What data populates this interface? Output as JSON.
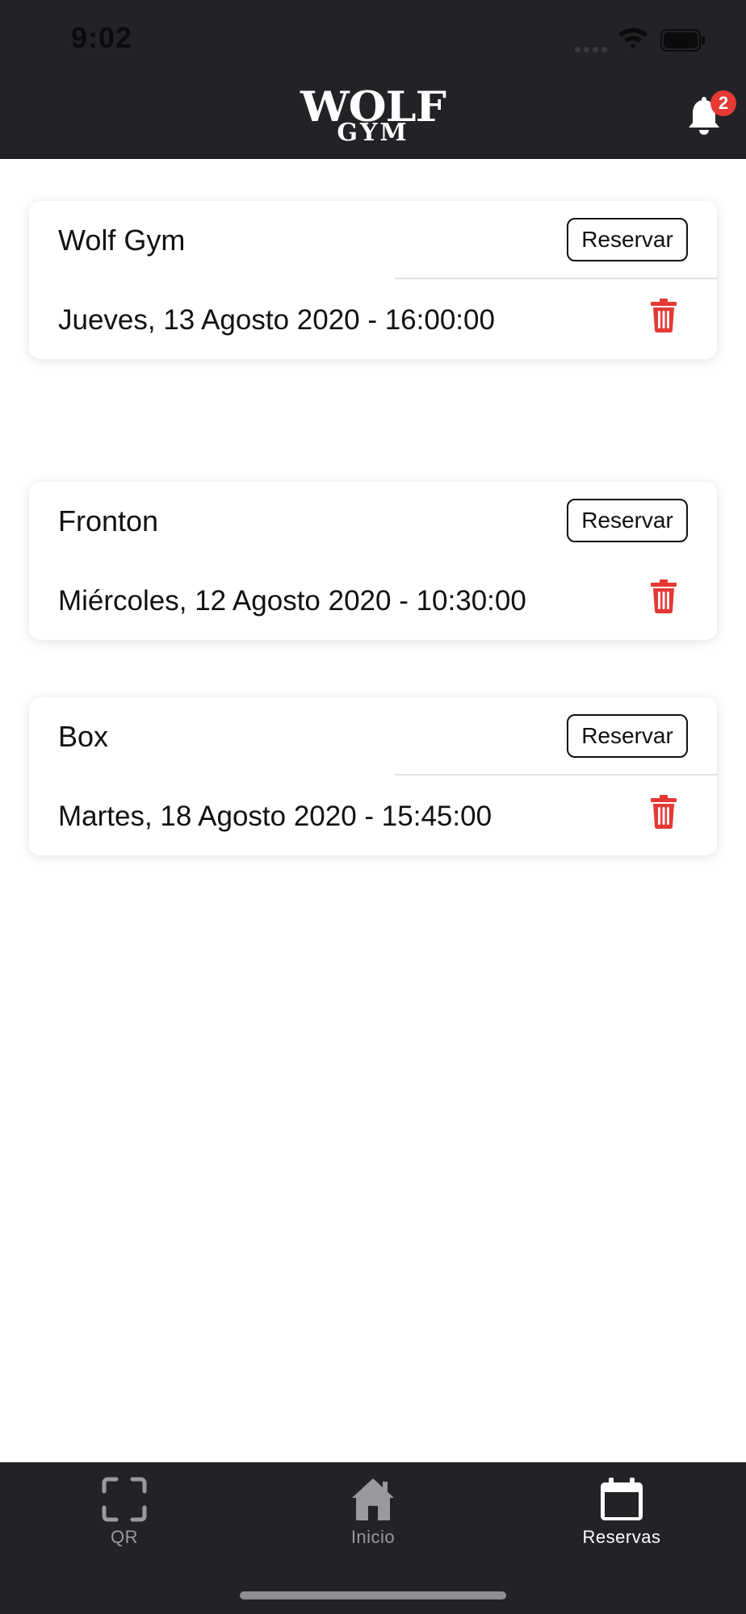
{
  "status_bar": {
    "time": "9:02"
  },
  "header": {
    "logo_line1": "WOLF",
    "logo_line2": "GYM",
    "notifications_count": "2"
  },
  "reservations": [
    {
      "name": "Wolf Gym",
      "button_label": "Reservar",
      "datetime": "Jueves, 13 Agosto 2020 - 16:00:00"
    },
    {
      "name": "Fronton",
      "button_label": "Reservar",
      "datetime": "Miércoles, 12 Agosto 2020 - 10:30:00"
    },
    {
      "name": "Box",
      "button_label": "Reservar",
      "datetime": "Martes, 18 Agosto 2020 - 15:45:00"
    }
  ],
  "tabbar": {
    "tabs": [
      {
        "label": "QR",
        "icon": "qr-scan-icon",
        "active": false
      },
      {
        "label": "Inicio",
        "icon": "home-icon",
        "active": false
      },
      {
        "label": "Reservas",
        "icon": "calendar-icon",
        "active": true
      }
    ]
  },
  "colors": {
    "header_bg": "#222326",
    "delete_red": "#e53935",
    "tab_inactive": "#9a9a9e",
    "tab_active": "#ffffff"
  }
}
